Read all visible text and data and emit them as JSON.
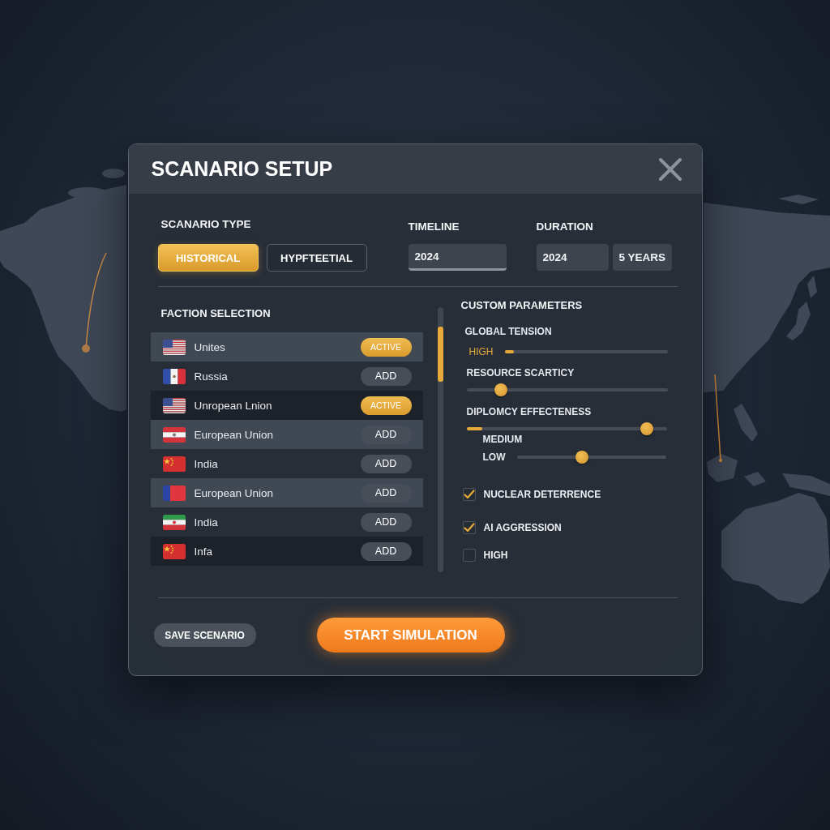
{
  "dialog": {
    "title": "SCANARIO SETUP"
  },
  "scenario_type": {
    "label": "SCANARIO TYPE",
    "options": [
      {
        "label": "HISTORICAL",
        "selected": true
      },
      {
        "label": "HYPFTEETIAL",
        "selected": false
      }
    ]
  },
  "timeline": {
    "label": "TIMELINE",
    "value": "2024"
  },
  "duration": {
    "label": "DURATION",
    "start": "2024",
    "length": "5 YEARS"
  },
  "faction_selection": {
    "title": "FACTION SELECTION",
    "factions": [
      {
        "kind": "stripes",
        "name": "Unites",
        "active": true,
        "action": "ACTIVE"
      },
      {
        "kind": "vertical",
        "name": "Russia",
        "active": false,
        "action": "ADD"
      },
      {
        "kind": "stripes",
        "name": "Unropean Lnion",
        "active": true,
        "action": "ACTIVE"
      },
      {
        "kind": "banded",
        "name": "European Union",
        "active": false,
        "action": "ADD"
      },
      {
        "kind": "stars",
        "name": "India",
        "active": false,
        "action": "ADD"
      },
      {
        "kind": "halves",
        "name": "European Union",
        "active": false,
        "action": "ADD"
      },
      {
        "kind": "horizontal",
        "name": "India",
        "active": false,
        "action": "ADD"
      },
      {
        "kind": "stars",
        "name": "Infa",
        "active": false,
        "action": "ADD"
      }
    ]
  },
  "custom_parameters": {
    "title": "CUSTOM PARAMETERS",
    "sliders": [
      {
        "kind": "fill",
        "label": "GLOBAL TENSION",
        "value": "HIGH",
        "level": 0.055
      },
      {
        "kind": "thumb",
        "label": "RESOURCE SCARTICY",
        "level": 0.17
      },
      {
        "kind": "marked",
        "label": "DIPLOMCY EFFECTENESS",
        "value": "MEDIUM",
        "level": 0.9
      },
      {
        "kind": "inline",
        "label": "LOW",
        "level": 0.44
      }
    ],
    "options": [
      {
        "label": "NUCLEAR DETERRENCE",
        "checked": true
      },
      {
        "label": "AI AGGRESSION",
        "checked": true
      },
      {
        "label": "HIGH",
        "checked": false
      }
    ]
  },
  "actions": {
    "save": "SAVE SCENARIO",
    "start": "START SIMULATION"
  }
}
